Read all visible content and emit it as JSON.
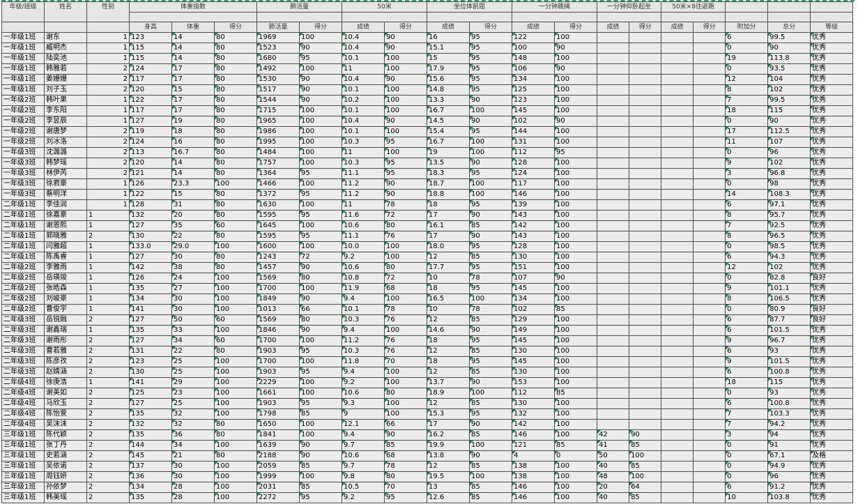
{
  "sheet": {
    "header": {
      "class_grade": "年级/班级",
      "name": "姓名",
      "sex": "性别",
      "groups": {
        "bmi": "体重指数",
        "lung": "肺活量",
        "run50": "50米",
        "sit_reach": "坐位体前屈",
        "rope": "一分钟跳绳",
        "situp": "一分钟仰卧起坐",
        "shuttle": "50米×8往返跑"
      },
      "sub": {
        "height": "身高",
        "weight": "体重",
        "bmi_score": "得分",
        "lung_value": "肺活量",
        "lung_score": "得分",
        "run_result": "成绩",
        "run_score": "得分",
        "sit_result": "成绩",
        "sit_score": "得分",
        "rope_result": "成绩",
        "rope_score": "得分",
        "situp_result": "成绩",
        "situp_score": "得分",
        "shuttle_result": "成绩",
        "shuttle_score": "得分",
        "bonus": "附加分",
        "total": "总分",
        "level": "等级"
      }
    },
    "rows": [
      [
        "一年级1班",
        "谢东",
        "1",
        "123",
        "14",
        "80",
        "1969",
        "100",
        "10.4",
        "90",
        "16",
        "95",
        "122",
        "100",
        "",
        "",
        "",
        "",
        "6",
        "99.5",
        "优秀"
      ],
      [
        "一年级1班",
        "臧明杰",
        "1",
        "115",
        "14",
        "80",
        "1523",
        "90",
        "10.4",
        "90",
        "15.1",
        "95",
        "100",
        "90",
        "",
        "",
        "",
        "",
        "0",
        "90",
        "优秀"
      ],
      [
        "一年级1班",
        "陆奕池",
        "1",
        "115",
        "14",
        "80",
        "1680",
        "95",
        "10.1",
        "100",
        "15",
        "95",
        "148",
        "100",
        "",
        "",
        "",
        "",
        "19",
        "113.8",
        "优秀"
      ],
      [
        "一年级1班",
        "韩雅若",
        "2",
        "124",
        "17",
        "80",
        "1492",
        "100",
        "11",
        "100",
        "17.9",
        "95",
        "106",
        "90",
        "",
        "",
        "",
        "",
        "0",
        "93.5",
        "优秀"
      ],
      [
        "一年级1班",
        "姜姗姗",
        "2",
        "117",
        "17",
        "80",
        "1530",
        "90",
        "10.4",
        "90",
        "15.6",
        "95",
        "134",
        "100",
        "",
        "",
        "",
        "",
        "12",
        "104",
        "优秀"
      ],
      [
        "一年级1班",
        "刘子玉",
        "2",
        "120",
        "15",
        "80",
        "1517",
        "90",
        "10.1",
        "100",
        "14.8",
        "95",
        "125",
        "100",
        "",
        "",
        "",
        "",
        "8",
        "102",
        "优秀"
      ],
      [
        "一年级2班",
        "韩叶果",
        "1",
        "122",
        "17",
        "80",
        "1544",
        "90",
        "10.2",
        "100",
        "13.3",
        "90",
        "123",
        "100",
        "",
        "",
        "",
        "",
        "7",
        "99.5",
        "优秀"
      ],
      [
        "一年级2班",
        "李东阳",
        "1",
        "117",
        "17",
        "80",
        "1715",
        "100",
        "10.1",
        "100",
        "16.7",
        "100",
        "145",
        "100",
        "",
        "",
        "",
        "",
        "18",
        "115",
        "优秀"
      ],
      [
        "一年级2班",
        "李昱辰",
        "1",
        "127",
        "19",
        "80",
        "1965",
        "100",
        "10.4",
        "90",
        "14.5",
        "90",
        "102",
        "90",
        "",
        "",
        "",
        "",
        "0",
        "90",
        "优秀"
      ],
      [
        "一年级2班",
        "谢唐梦",
        "2",
        "119",
        "18",
        "80",
        "1986",
        "100",
        "10.1",
        "100",
        "15.4",
        "95",
        "144",
        "100",
        "",
        "",
        "",
        "",
        "17",
        "112.5",
        "优秀"
      ],
      [
        "一年级2班",
        "刘冰洛",
        "2",
        "124",
        "16",
        "80",
        "1995",
        "100",
        "10.3",
        "95",
        "16.7",
        "100",
        "131",
        "100",
        "",
        "",
        "",
        "",
        "11",
        "107",
        "优秀"
      ],
      [
        "一年级3班",
        "沈潞潞",
        "2",
        "113",
        "16.7",
        "80",
        "1484",
        "100",
        "11",
        "100",
        "19",
        "100",
        "112",
        "95",
        "",
        "",
        "",
        "",
        "0",
        "96",
        "优秀"
      ],
      [
        "一年级3班",
        "韩梦瑶",
        "2",
        "120",
        "14",
        "80",
        "1757",
        "100",
        "10.3",
        "95",
        "13.5",
        "90",
        "128",
        "100",
        "",
        "",
        "",
        "",
        "9",
        "102",
        "优秀"
      ],
      [
        "一年级3班",
        "林伊芮",
        "2",
        "121",
        "14",
        "80",
        "1364",
        "95",
        "11.1",
        "95",
        "18.3",
        "95",
        "124",
        "100",
        "",
        "",
        "",
        "",
        "3",
        "96.8",
        "优秀"
      ],
      [
        "一年级3班",
        "徐君豪",
        "1",
        "126",
        "23.3",
        "100",
        "1466",
        "100",
        "11.2",
        "90",
        "18.7",
        "100",
        "117",
        "100",
        "",
        "",
        "",
        "",
        "0",
        "98",
        "优秀"
      ],
      [
        "一年级3班",
        "蔡明洋",
        "1",
        "122",
        "15",
        "80",
        "1372",
        "95",
        "11.2",
        "90",
        "18.8",
        "100",
        "146",
        "100",
        "",
        "",
        "",
        "",
        "14",
        "108.3",
        "优秀"
      ],
      [
        "二年级1班",
        "李佳润",
        "1",
        "128",
        "31",
        "80",
        "1630",
        "100",
        "11",
        "78",
        "18",
        "95",
        "139",
        "100",
        "",
        "",
        "",
        "",
        "6",
        "97.1",
        "优秀"
      ],
      [
        "二年级1班",
        "徐嘉豪",
        "1",
        "132",
        "20",
        "80",
        "1595",
        "95",
        "11.6",
        "72",
        "17",
        "90",
        "143",
        "100",
        "",
        "",
        "",
        "",
        "8",
        "95.7",
        "优秀"
      ],
      [
        "二年级1班",
        "谢恩熙",
        "1",
        "127",
        "35",
        "60",
        "1645",
        "100",
        "10.6",
        "80",
        "16.1",
        "85",
        "142",
        "100",
        "",
        "",
        "",
        "",
        "7",
        "92.5",
        "优秀"
      ],
      [
        "二年级1班",
        "郭晓雅",
        "2",
        "130",
        "22",
        "80",
        "1595",
        "95",
        "11.1",
        "76",
        "17",
        "90",
        "143",
        "100",
        "",
        "",
        "",
        "",
        "8",
        "96.5",
        "优秀"
      ],
      [
        "二年级1班",
        "闫雅超",
        "1",
        "133.0",
        "29.0",
        "100",
        "1600",
        "100",
        "10.0",
        "100",
        "18.0",
        "95",
        "128",
        "100",
        "",
        "",
        "",
        "",
        "0",
        "98.5",
        "优秀"
      ],
      [
        "二年级1班",
        "陈禹睿",
        "1",
        "127",
        "30",
        "80",
        "1243",
        "72",
        "9.2",
        "100",
        "12",
        "85",
        "130",
        "100",
        "",
        "",
        "",
        "",
        "6",
        "94.3",
        "优秀"
      ],
      [
        "二年级2班",
        "李雅雨",
        "1",
        "142",
        "38",
        "80",
        "1457",
        "90",
        "10.6",
        "80",
        "17.7",
        "95",
        "151",
        "100",
        "",
        "",
        "",
        "",
        "12",
        "102",
        "优秀"
      ],
      [
        "二年级2班",
        "岳瑛竣",
        "1",
        "126",
        "24",
        "100",
        "1569",
        "80",
        "10.8",
        "72",
        "10",
        "78",
        "107",
        "90",
        "",
        "",
        "",
        "",
        "0",
        "82.8",
        "良好"
      ],
      [
        "二年级2班",
        "张皓森",
        "1",
        "135",
        "27",
        "100",
        "1700",
        "100",
        "11.9",
        "68",
        "18",
        "95",
        "145",
        "100",
        "",
        "",
        "",
        "",
        "9",
        "101.1",
        "优秀"
      ],
      [
        "二年级2班",
        "刘峻豪",
        "1",
        "134",
        "30",
        "100",
        "1849",
        "90",
        "9.4",
        "100",
        "16.5",
        "100",
        "134",
        "100",
        "",
        "",
        "",
        "",
        "8",
        "106.5",
        "优秀"
      ],
      [
        "二年级2班",
        "曹俊宇",
        "1",
        "141",
        "30",
        "100",
        "1013",
        "66",
        "10.1",
        "78",
        "10",
        "78",
        "102",
        "85",
        "",
        "",
        "",
        "",
        "0",
        "80.9",
        "良好"
      ],
      [
        "二年级3班",
        "岳锐融",
        "2",
        "127",
        "50",
        "60",
        "1569",
        "80",
        "10.3",
        "76",
        "12",
        "85",
        "129",
        "100",
        "",
        "",
        "",
        "",
        "6",
        "87.7",
        "良好"
      ],
      [
        "二年级3班",
        "谢鑫瑞",
        "1",
        "135",
        "33",
        "100",
        "1846",
        "90",
        "9.4",
        "100",
        "14.6",
        "90",
        "149",
        "100",
        "",
        "",
        "",
        "",
        "6",
        "101.5",
        "优秀"
      ],
      [
        "二年级3班",
        "谢雨彤",
        "2",
        "127",
        "34",
        "60",
        "1700",
        "100",
        "11.2",
        "76",
        "18",
        "95",
        "145",
        "100",
        "",
        "",
        "",
        "",
        "9",
        "96.7",
        "优秀"
      ],
      [
        "二年级3班",
        "曹若雅",
        "2",
        "131",
        "22",
        "80",
        "1903",
        "95",
        "10.3",
        "76",
        "12",
        "85",
        "130",
        "100",
        "",
        "",
        "",
        "",
        "6",
        "93",
        "优秀"
      ],
      [
        "二年级3班",
        "陈彦孜",
        "2",
        "123",
        "25",
        "100",
        "1700",
        "100",
        "11.8",
        "70",
        "18",
        "95",
        "145",
        "100",
        "",
        "",
        "",
        "",
        "9",
        "101.5",
        "优秀"
      ],
      [
        "二年级3班",
        "赵婧涵",
        "2",
        "130",
        "25",
        "100",
        "1903",
        "95",
        "9.4",
        "100",
        "12",
        "85",
        "130",
        "100",
        "",
        "",
        "",
        "",
        "6",
        "100.8",
        "优秀"
      ],
      [
        "二年级4班",
        "徐庚浩",
        "1",
        "141",
        "29",
        "100",
        "2229",
        "100",
        "9.2",
        "100",
        "13.7",
        "90",
        "153",
        "100",
        "",
        "",
        "",
        "",
        "18",
        "115",
        "优秀"
      ],
      [
        "二年级4班",
        "谢美如",
        "2",
        "125",
        "23",
        "100",
        "1661",
        "100",
        "10.6",
        "80",
        "18.9",
        "100",
        "112",
        "85",
        "",
        "",
        "",
        "",
        "0",
        "93",
        "优秀"
      ],
      [
        "二年级4班",
        "马欣玉",
        "2",
        "127",
        "25",
        "100",
        "1903",
        "95",
        "9.3",
        "100",
        "12",
        "85",
        "130",
        "100",
        "",
        "",
        "",
        "",
        "6",
        "100.8",
        "优秀"
      ],
      [
        "二年级4班",
        "陈怡萱",
        "2",
        "135",
        "32",
        "100",
        "1798",
        "85",
        "9",
        "100",
        "15.3",
        "95",
        "132",
        "100",
        "",
        "",
        "",
        "",
        "7",
        "103.3",
        "优秀"
      ],
      [
        "二年级4班",
        "吴沫沫",
        "2",
        "132",
        "32",
        "80",
        "1650",
        "100",
        "12.1",
        "66",
        "17",
        "90",
        "142",
        "100",
        "",
        "",
        "",
        "",
        "7",
        "94.2",
        "优秀"
      ],
      [
        "三年级1班",
        "陈代颖",
        "2",
        "135",
        "36",
        "80",
        "1841",
        "100",
        "9.4",
        "90",
        "16.2",
        "85",
        "146",
        "100",
        "42",
        "90",
        "",
        "",
        "3",
        "94",
        "优秀"
      ],
      [
        "三年级1班",
        "张丁丹",
        "2",
        "144",
        "34",
        "100",
        "1639",
        "90",
        "9.7",
        "85",
        "19.9",
        "100",
        "121",
        "85",
        "41",
        "85",
        "",
        "",
        "0",
        "91",
        "优秀"
      ],
      [
        "三年级1班",
        "史若涵",
        "2",
        "145",
        "21",
        "80",
        "2188",
        "90",
        "10.6",
        "68",
        "13.8",
        "90",
        "4",
        "0",
        "50",
        "100",
        "",
        "",
        "0",
        "67.1",
        "及格"
      ],
      [
        "三年级1班",
        "吴依诺",
        "2",
        "137",
        "30",
        "100",
        "2059",
        "85",
        "9.7",
        "78",
        "12",
        "85",
        "138",
        "100",
        "40",
        "85",
        "",
        "",
        "0",
        "94.9",
        "优秀"
      ],
      [
        "三年级1班",
        "周钰妍",
        "2",
        "136",
        "30",
        "100",
        "1999",
        "100",
        "9.8",
        "80",
        "19.5",
        "100",
        "138",
        "100",
        "48",
        "100",
        "",
        "",
        "0",
        "96",
        "优秀"
      ],
      [
        "三年级1班",
        "孙依梦",
        "2",
        "134",
        "28",
        "100",
        "2031",
        "85",
        "10.5",
        "70",
        "13",
        "85",
        "146",
        "100",
        "20",
        "64",
        "",
        "",
        "6",
        "91.2",
        "优秀"
      ],
      [
        "三年级1班",
        "韩美瑶",
        "2",
        "135",
        "28",
        "100",
        "2272",
        "95",
        "9.2",
        "95",
        "12.6",
        "85",
        "146",
        "100",
        "40",
        "85",
        "",
        "",
        "10",
        "103.8",
        "优秀"
      ]
    ]
  }
}
